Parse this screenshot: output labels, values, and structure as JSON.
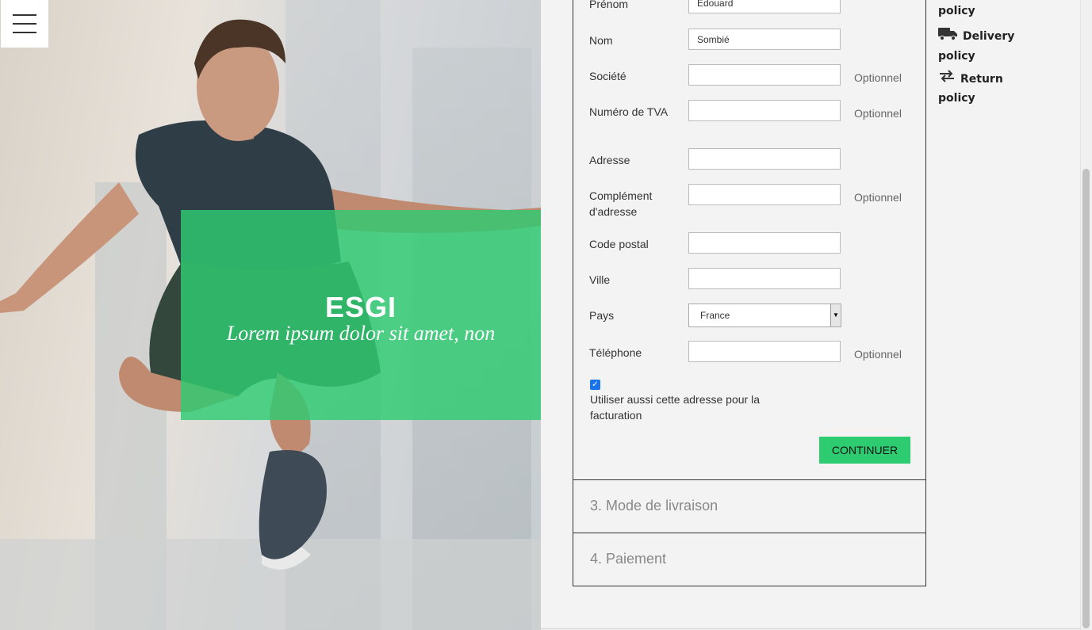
{
  "hero": {
    "title": "ESGI",
    "subtitle": "Lorem ipsum dolor sit amet, non"
  },
  "menu": {
    "icon": "hamburger-menu-icon"
  },
  "form": {
    "fields": [
      {
        "label": "Prénom",
        "value": "Edouard",
        "optional": ""
      },
      {
        "label": "Nom",
        "value": "Sombié",
        "optional": ""
      },
      {
        "label": "Société",
        "value": "",
        "optional": "Optionnel"
      },
      {
        "label": "Numéro de TVA",
        "value": "",
        "optional": "Optionnel"
      },
      {
        "label": "Adresse",
        "value": "",
        "optional": ""
      },
      {
        "label": "Complément d'adresse",
        "value": "",
        "optional": "Optionnel"
      },
      {
        "label": "Code postal",
        "value": "",
        "optional": ""
      },
      {
        "label": "Ville",
        "value": "",
        "optional": ""
      },
      {
        "label": "Pays",
        "value": "France",
        "optional": ""
      },
      {
        "label": "Téléphone",
        "value": "",
        "optional": "Optionnel"
      }
    ],
    "billing_checkbox": {
      "checked": true,
      "label": "Utiliser aussi cette adresse pour la facturation"
    },
    "continue_label": "CONTINUER"
  },
  "steps": [
    {
      "label": "3. Mode de livraison"
    },
    {
      "label": "4. Paiement"
    }
  ],
  "policies": {
    "security_tail": "policy",
    "delivery": {
      "label": "Delivery",
      "tail": "policy",
      "icon": "truck-icon"
    },
    "return": {
      "label": "Return",
      "tail": "policy",
      "icon": "exchange-arrows-icon"
    }
  },
  "colors": {
    "accent": "#2ecc71",
    "panel_bg": "#f3f3f3",
    "border": "#333333"
  }
}
